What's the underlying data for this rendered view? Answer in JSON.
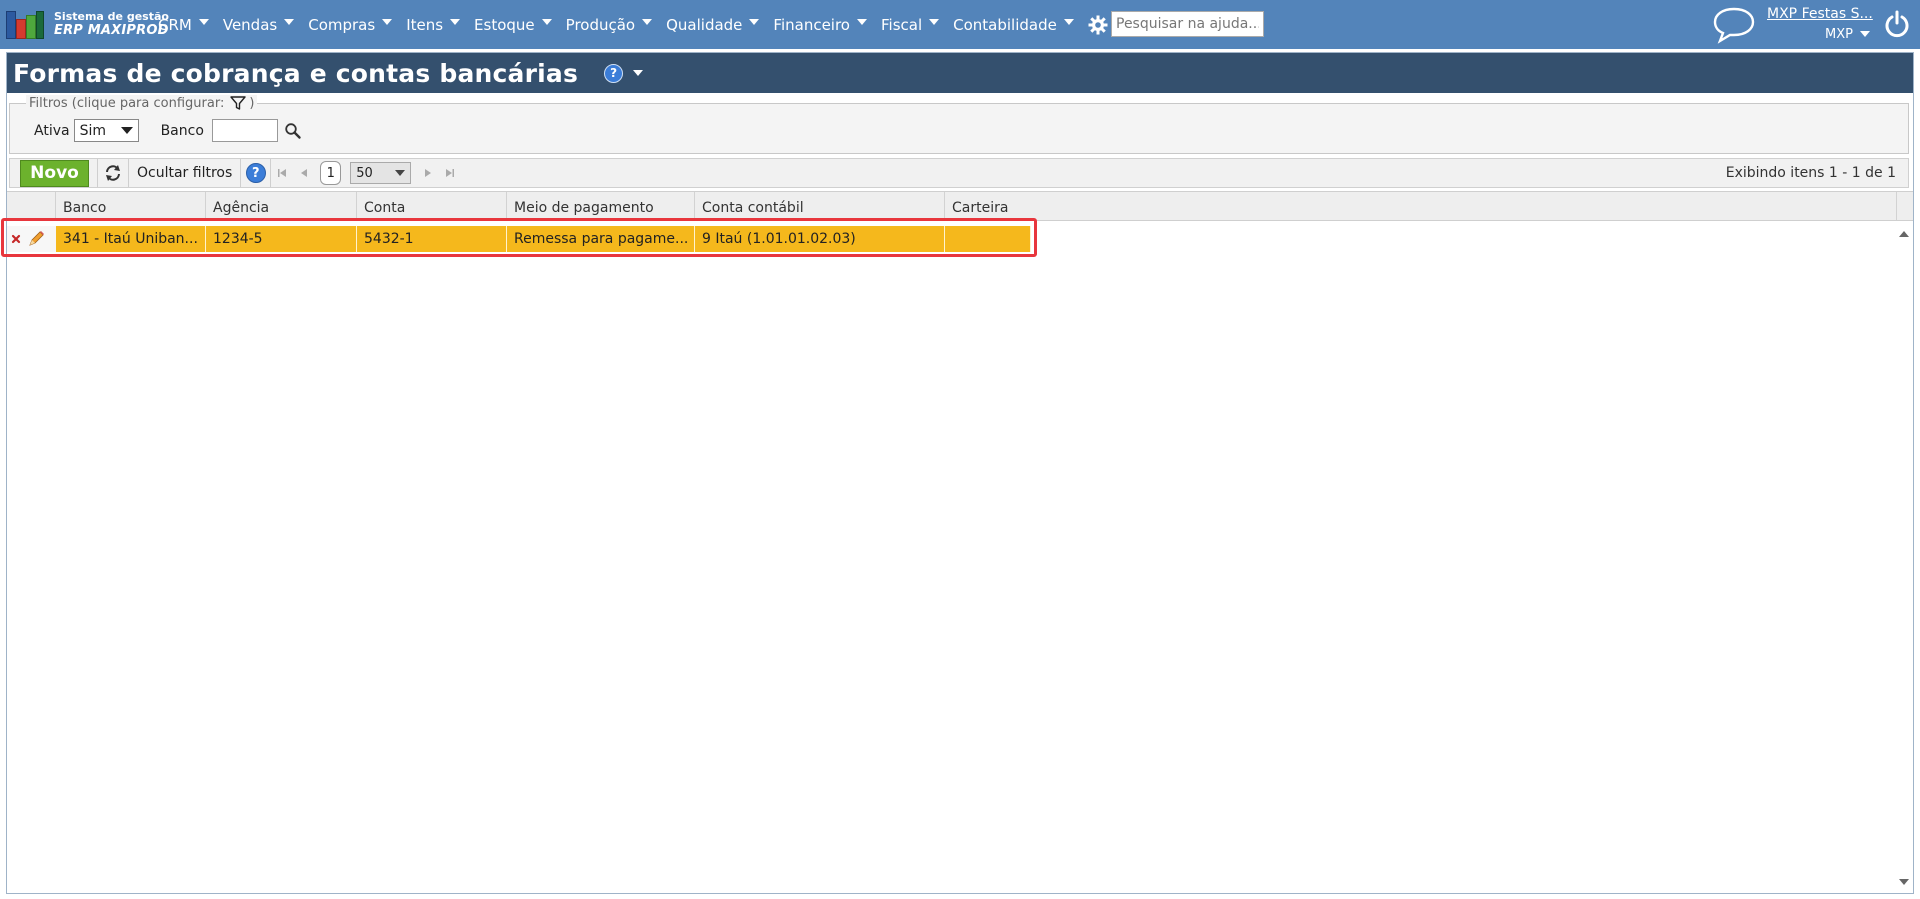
{
  "app": {
    "logo_line1": "Sistema de gestão",
    "logo_line2": "ERP MAXIPROD"
  },
  "nav": {
    "items": [
      {
        "label": "CRM"
      },
      {
        "label": "Vendas"
      },
      {
        "label": "Compras"
      },
      {
        "label": "Itens"
      },
      {
        "label": "Estoque"
      },
      {
        "label": "Produção"
      },
      {
        "label": "Qualidade"
      },
      {
        "label": "Financeiro"
      },
      {
        "label": "Fiscal"
      },
      {
        "label": "Contabilidade"
      }
    ],
    "help_placeholder": "Pesquisar na ajuda...",
    "user_name": "MXP Festas S...",
    "company": "MXP"
  },
  "page": {
    "title": "Formas de cobrança e contas bancárias"
  },
  "filters": {
    "legend_prefix": "Filtros (clique para configurar:",
    "legend_suffix": ")",
    "ativa_label": "Ativa",
    "ativa_value": "Sim",
    "banco_label": "Banco",
    "banco_value": ""
  },
  "toolbar": {
    "novo_label": "Novo",
    "hide_filters_label": "Ocultar filtros",
    "current_page": "1",
    "page_size": "50",
    "showing_text": "Exibindo itens 1 - 1 de 1"
  },
  "grid": {
    "columns": [
      "Banco",
      "Agência",
      "Conta",
      "Meio de pagamento",
      "Conta contábil",
      "Carteira"
    ],
    "rows": [
      [
        "341 - Itaú Uniban...",
        "1234-5",
        "5432-1",
        "Remessa para pagame...",
        "9 Itaú (1.01.01.02.03)",
        ""
      ]
    ]
  },
  "colors": {
    "navbar": "#5384ba",
    "page_header": "#34506e",
    "row_selected": "#f5b81c",
    "highlight_border": "#e8363d",
    "novo_button": "#6cb22d"
  }
}
